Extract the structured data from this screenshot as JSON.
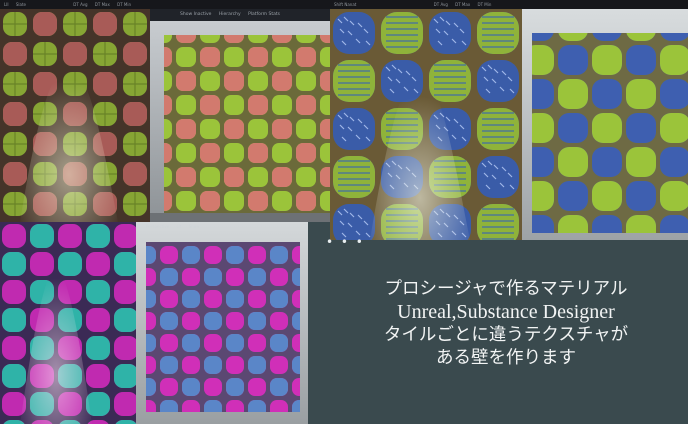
{
  "viewports": {
    "top_left": {
      "labels": [
        "LII",
        "Slate",
        "DT Avg",
        "DT Max",
        "DT Min"
      ]
    },
    "top_second": {
      "labels": [
        "Perspective",
        "Lit",
        "Show"
      ]
    },
    "top_center": {
      "labels": [
        "Shift Nanat",
        "DT Avg",
        "DT Max",
        "DT Min"
      ]
    },
    "top_right": {
      "labels": [
        "Perspective",
        "Lit",
        "Show"
      ]
    },
    "bottom_second": {
      "labels": [
        "Perspective",
        "Lit",
        "Show"
      ]
    }
  },
  "toolbar": {
    "items": [
      "Show Inactive",
      "Hierarchy",
      "Platform Stats"
    ]
  },
  "separator": {
    "text": "• • •"
  },
  "caption": {
    "line1": "プロシージャで作るマテリアル",
    "line2": "Unreal,Substance Designer",
    "line3": "タイルごとに違うテクスチャが",
    "line4": "ある壁を作ります"
  },
  "colors": {
    "background": "#3a4a4e",
    "panel_dark": "#1d1f24",
    "tile_green": "#9bc43a",
    "tile_pink": "#d27a6e",
    "tile_blue": "#3a5ca8",
    "tile_magenta": "#c02ab0",
    "tile_teal": "#2fb3a8",
    "grout_brown": "#5a4630",
    "grout_olive": "#6b6a3a",
    "caption_text": "#f2f4f4"
  },
  "panels": [
    {
      "id": "panel-top-left",
      "theme": "green-pink-dark"
    },
    {
      "id": "panel-top-second",
      "theme": "green-pink-light"
    },
    {
      "id": "panel-top-center",
      "theme": "blue-green"
    },
    {
      "id": "panel-top-right",
      "theme": "blue-green-light"
    },
    {
      "id": "panel-bottom-left",
      "theme": "magenta-teal"
    },
    {
      "id": "panel-bottom-second",
      "theme": "magenta-blue"
    }
  ]
}
